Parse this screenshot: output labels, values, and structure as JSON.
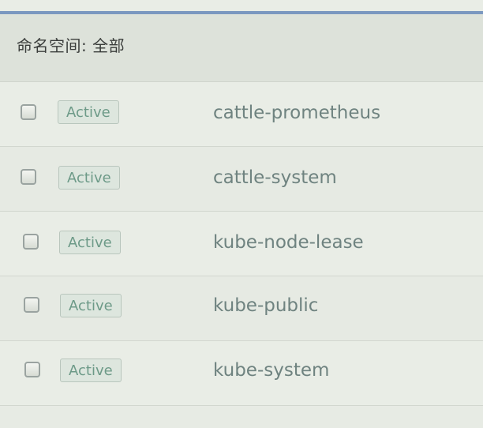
{
  "group": {
    "label": "命名空间: 全部"
  },
  "rows": [
    {
      "state": "Active",
      "name": "cattle-prometheus"
    },
    {
      "state": "Active",
      "name": "cattle-system"
    },
    {
      "state": "Active",
      "name": "kube-node-lease"
    },
    {
      "state": "Active",
      "name": "kube-public"
    },
    {
      "state": "Active",
      "name": "kube-system"
    }
  ],
  "colors": {
    "accent": "#7b98c0",
    "badge_text": "#6d9a88",
    "name_text": "#6f8380"
  }
}
